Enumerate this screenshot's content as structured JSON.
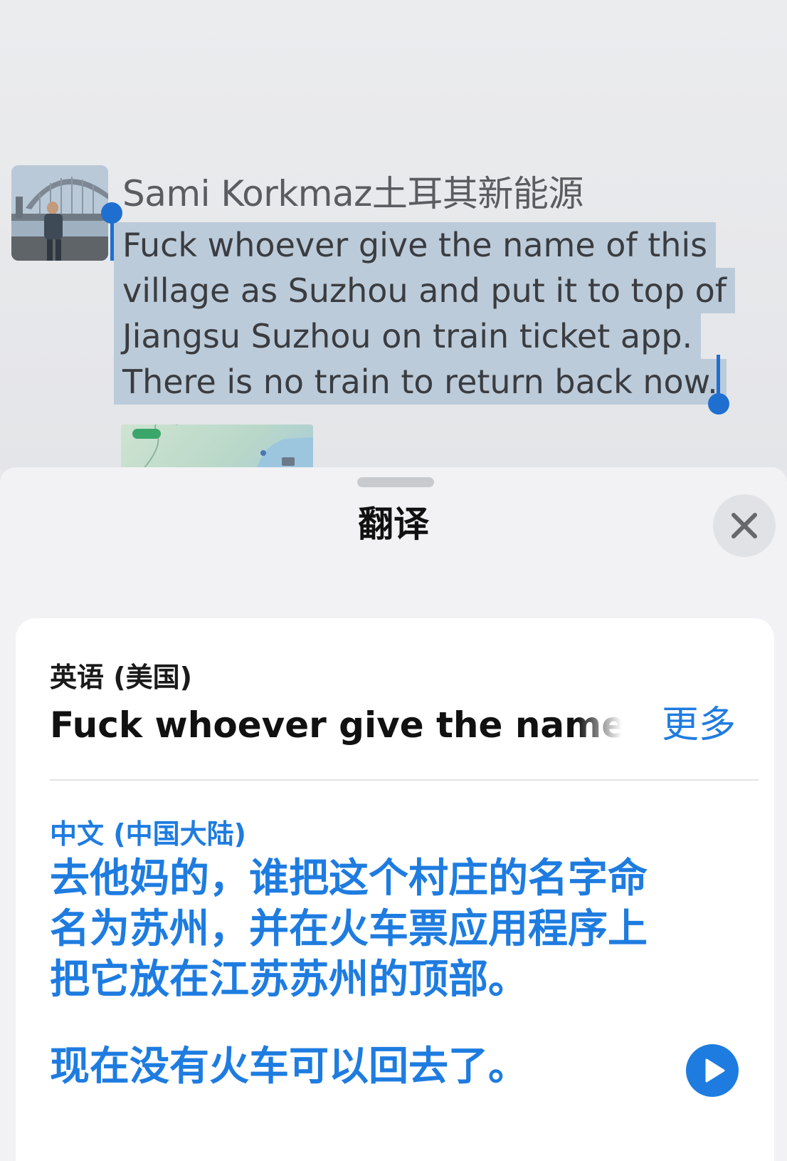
{
  "chat": {
    "sender_name": "Sami Korkmaz土耳其新能源",
    "message_lines": [
      "Fuck whoever give the name of this",
      "village as Suzhou and put it to top of",
      "Jiangsu Suzhou on train ticket app.",
      "There is no train to return back now."
    ],
    "avatar_icon": "avatar-photo",
    "thumbnail_icon": "map-thumbnail"
  },
  "translate_sheet": {
    "title": "翻译",
    "close_icon": "close-icon",
    "source_language": "英语 (美国)",
    "source_text": "Fuck whoever give the name of",
    "more_label": "更多",
    "target_language": "中文 (中国大陆)",
    "target_lines": [
      "去他妈的，谁把这个村庄的名字命",
      "名为苏州，并在火车票应用程序上",
      "把它放在江苏苏州的顶部。"
    ],
    "target_last_line": "现在没有火车可以回去了。",
    "play_icon": "play-icon",
    "accent_color": "#1e7ce0",
    "selection_color": "#bccbd9"
  }
}
